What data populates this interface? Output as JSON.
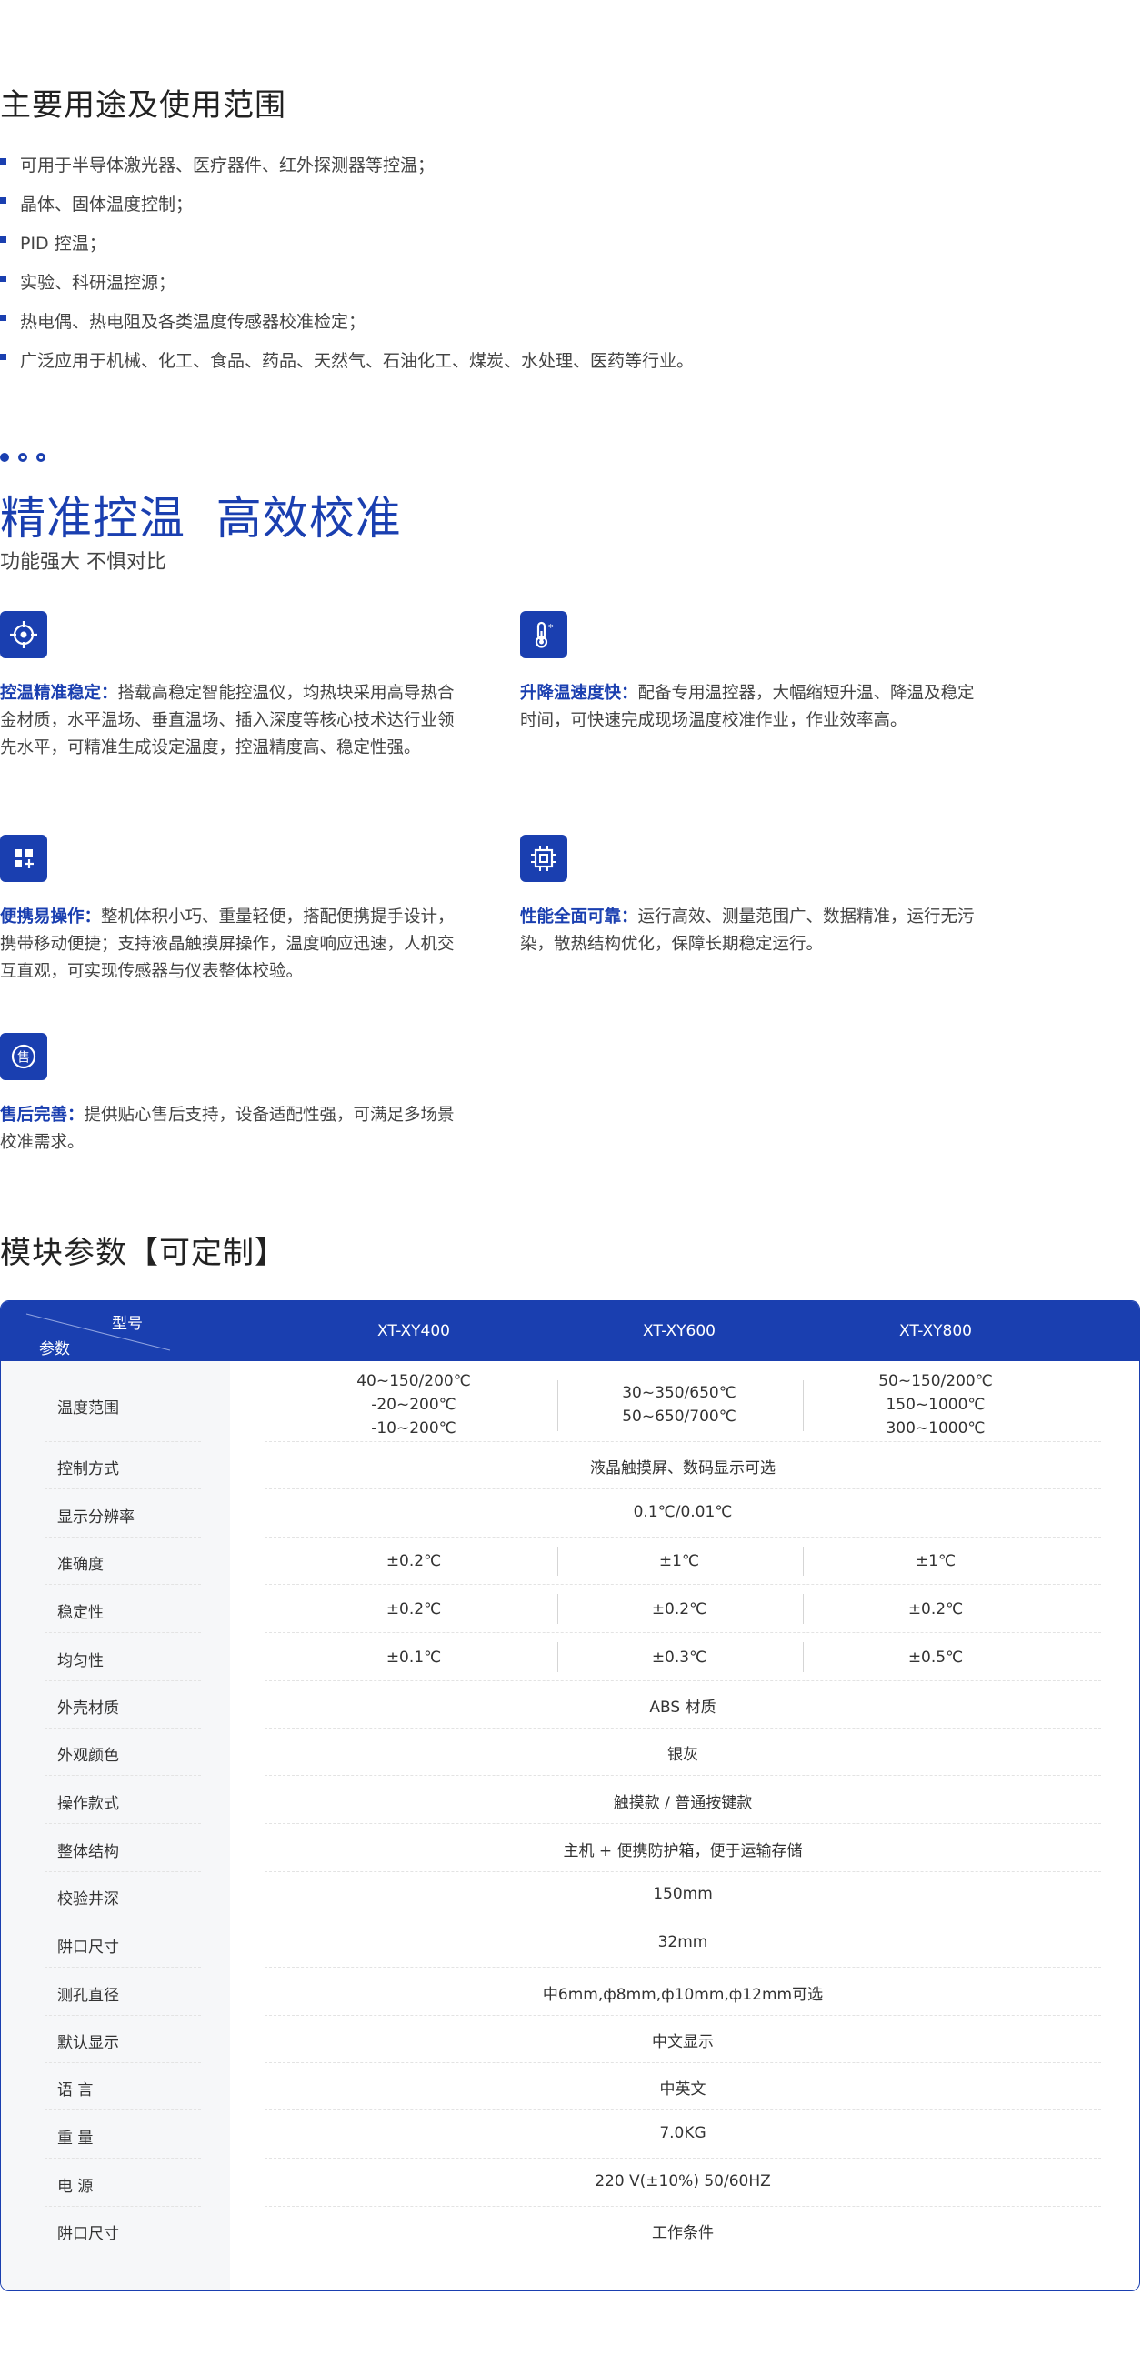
{
  "uses": {
    "title": "主要用途及使用范围",
    "items": [
      "可用于半导体激光器、医疗器件、红外探测器等控温；",
      "晶体、固体温度控制；",
      "PID 控温；",
      "实验、科研温控源；",
      "热电偶、热电阻及各类温度传感器校准检定；",
      "广泛应用于机械、化工、食品、药品、天然气、石油化工、煤炭、水处理、医药等行业。"
    ]
  },
  "features": {
    "title": "精准控温  高效校准",
    "subtitle": "功能强大 不惧对比",
    "items": [
      {
        "icon": "target-icon",
        "head": "控温精准稳定：",
        "body": "搭载高稳定智能控温仪，均热块采用高导热合金材质，水平温场、垂直温场、插入深度等核心技术达行业领先水平，可精准生成设定温度，控温精度高、稳定性强。"
      },
      {
        "icon": "thermometer-icon",
        "head": "升降温速度快：",
        "body": "配备专用温控器，大幅缩短升温、降温及稳定时间，可快速完成现场温度校准作业，作业效率高。"
      },
      {
        "icon": "grid-plus-icon",
        "head": "便携易操作：",
        "body": "整机体积小巧、重量轻便，搭配便携提手设计，携带移动便捷；支持液晶触摸屏操作，温度响应迅速，人机交互直观，可实现传感器与仪表整体校验。"
      },
      {
        "icon": "chip-icon",
        "head": "性能全面可靠：",
        "body": "运行高效、测量范围广、数据精准，运行无污染，散热结构优化，保障长期稳定运行。"
      },
      {
        "icon": "service-icon",
        "head": "售后完善：",
        "body": "提供贴心售后支持，设备适配性强，可满足多场景校准需求。"
      }
    ],
    "service_icon_char": "售"
  },
  "params": {
    "title": "模块参数【可定制】",
    "header": {
      "model": "型号",
      "param": "参数",
      "models": [
        "XT-XY400",
        "XT-XY600",
        "XT-XY800"
      ]
    },
    "rows": [
      {
        "name": "温度范围",
        "cells": [
          "40~150/200℃\n-20~200℃\n-10~200℃",
          "30~350/650℃\n50~650/700℃",
          "50~150/200℃\n150~1000℃\n300~1000℃"
        ]
      },
      {
        "name": "控制方式",
        "cells": [
          "液晶触摸屏、数码显示可选"
        ]
      },
      {
        "name": "显示分辨率",
        "cells": [
          "0.1℃/0.01℃"
        ]
      },
      {
        "name": "准确度",
        "cells": [
          "±0.2℃",
          "±1℃",
          "±1℃"
        ]
      },
      {
        "name": "稳定性",
        "cells": [
          "±0.2℃",
          "±0.2℃",
          "±0.2℃"
        ]
      },
      {
        "name": "均匀性",
        "cells": [
          "±0.1℃",
          "±0.3℃",
          "±0.5℃"
        ]
      },
      {
        "name": "外壳材质",
        "cells": [
          "ABS 材质"
        ]
      },
      {
        "name": "外观颜色",
        "cells": [
          "银灰"
        ]
      },
      {
        "name": "操作款式",
        "cells": [
          "触摸款 / 普通按键款"
        ]
      },
      {
        "name": "整体结构",
        "cells": [
          "主机 + 便携防护箱，便于运输存储"
        ]
      },
      {
        "name": "校验井深",
        "cells": [
          "150mm"
        ]
      },
      {
        "name": "阱口尺寸",
        "cells": [
          "32mm"
        ]
      },
      {
        "name": "测孔直径",
        "cells": [
          "中6mm,ф8mm,ф10mm,ф12mm可选"
        ]
      },
      {
        "name": "默认显示",
        "cells": [
          "中文显示"
        ]
      },
      {
        "name": "语 言",
        "cells": [
          "中英文"
        ]
      },
      {
        "name": "重 量",
        "cells": [
          "7.0KG"
        ]
      },
      {
        "name": "电 源",
        "cells": [
          "220 V(±10%)  50/60HZ"
        ]
      },
      {
        "name": "阱口尺寸",
        "cells": [
          "工作条件"
        ]
      }
    ]
  },
  "colors": {
    "accent": "#1a3fb0"
  }
}
